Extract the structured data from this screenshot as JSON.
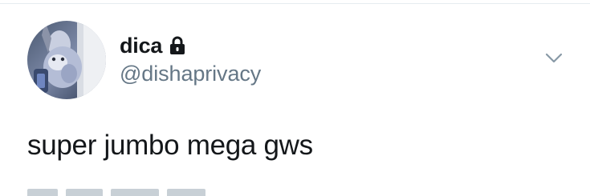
{
  "user": {
    "display_name": "dica",
    "handle": "@dishaprivacy",
    "protected_icon": "lock-icon",
    "avatar_icon": "profile-photo"
  },
  "tweet": {
    "text": "super jumbo mega gws"
  },
  "menu": {
    "icon": "chevron-down-icon"
  },
  "colors": {
    "primary_text": "#14171a",
    "secondary_text": "#657786",
    "divider": "#e6ecf0"
  }
}
